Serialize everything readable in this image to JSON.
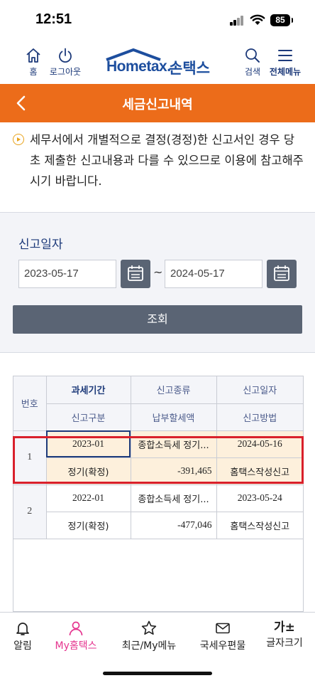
{
  "status_bar": {
    "time": "12:51",
    "battery": "85"
  },
  "header": {
    "home_label": "홈",
    "logout_label": "로그아웃",
    "logo_main": "Hometax.",
    "logo_sub": "손택스",
    "search_label": "검색",
    "menu_label": "전체메뉴"
  },
  "title_bar": {
    "title": "세금신고내역"
  },
  "notice": {
    "text": "세무서에서 개별적으로 결정(경정)한 신고서인 경우 당초 제출한 신고내용과 다를 수 있으므로 이용에 참고해주시기 바랍니다."
  },
  "search": {
    "label": "신고일자",
    "date_from": "2023-05-17",
    "tilde": "~",
    "date_to": "2024-05-17",
    "query_button": "조회"
  },
  "table": {
    "headers": {
      "number": "번호",
      "period": "과세기간",
      "report_type": "신고종류",
      "report_date": "신고일자",
      "category": "신고구분",
      "tax_amount": "납부할세액",
      "method": "신고방법"
    },
    "rows": [
      {
        "number": "1",
        "period": "2023-01",
        "report_type": "종합소득세 정기...",
        "report_date": "2024-05-16",
        "category": "정기(확정)",
        "tax_amount": "-391,465",
        "method": "홈택스작성신고"
      },
      {
        "number": "2",
        "period": "2022-01",
        "report_type": "종합소득세 정기...",
        "report_date": "2023-05-24",
        "category": "정기(확정)",
        "tax_amount": "-477,046",
        "method": "홈택스작성신고"
      }
    ]
  },
  "bottom_nav": {
    "alarm": "알림",
    "my_hometax": "My홈택스",
    "recent": "최근/My메뉴",
    "post": "국세우편물",
    "font_glyph": "가±",
    "font_size": "글자크기"
  },
  "colors": {
    "accent": "#ec6c1a",
    "brand": "#1d4e9e",
    "highlight": "#d9202b",
    "active_nav": "#e5358f"
  }
}
